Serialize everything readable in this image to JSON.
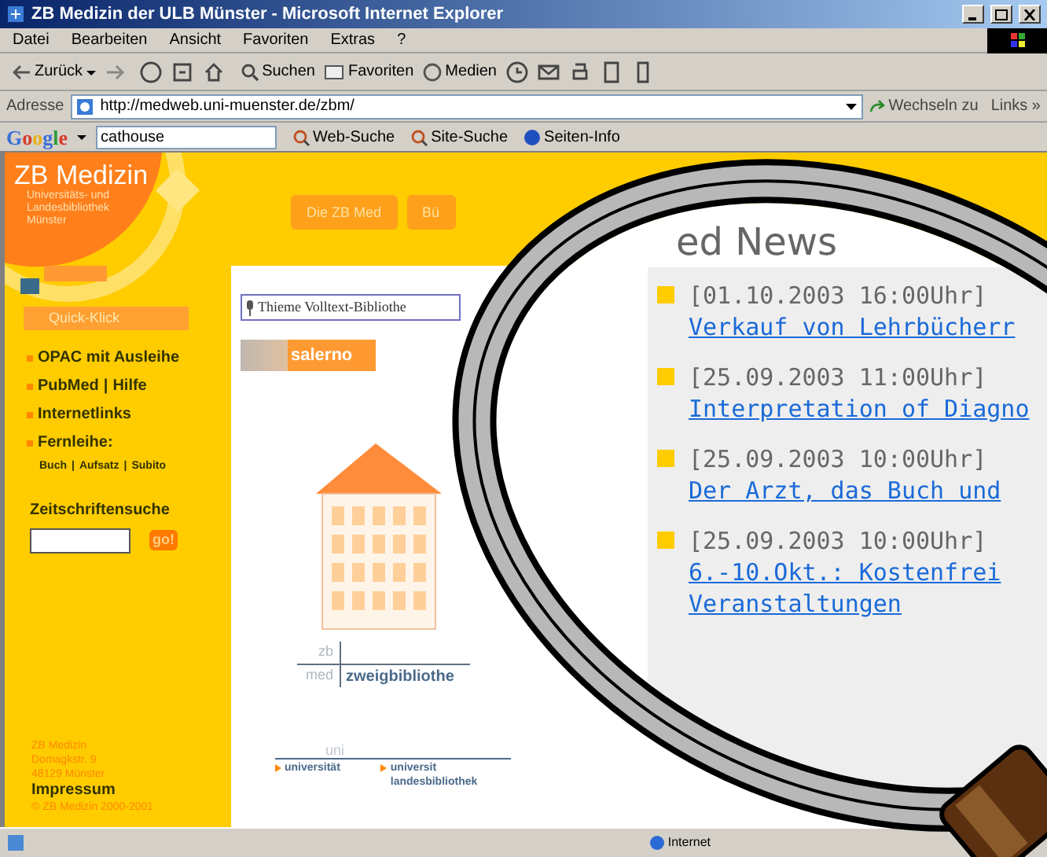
{
  "window": {
    "title": "ZB Medizin der ULB Münster - Microsoft Internet Explorer"
  },
  "menu": [
    "Datei",
    "Bearbeiten",
    "Ansicht",
    "Favoriten",
    "Extras",
    "?"
  ],
  "toolbar": {
    "back": "Zurück",
    "search": "Suchen",
    "favorites": "Favoriten",
    "media": "Medien"
  },
  "address_bar": {
    "label": "Adresse",
    "value": "http://medweb.uni-muenster.de/zbm/",
    "go": "Wechseln zu",
    "links": "Links »"
  },
  "google_bar": {
    "logo": "Google",
    "query": "cathouse",
    "buttons": [
      "Web-Suche",
      "Site-Suche",
      "Seiten-Info"
    ]
  },
  "sidebar": {
    "logo_title": "ZB Medizin",
    "logo_subtitle": [
      "Universitäts- und",
      "Landesbibliothek",
      "Münster"
    ],
    "quick_title": "Quick-Klick",
    "links": [
      {
        "parts": [
          "OPAC mit Ausleihe"
        ]
      },
      {
        "parts": [
          "PubMed",
          "|",
          "Hilfe"
        ]
      },
      {
        "parts": [
          "Internetlinks"
        ]
      },
      {
        "parts": [
          "Fernleihe:"
        ]
      }
    ],
    "sublinks": [
      "Buch",
      "|",
      "Aufsatz",
      "|",
      "Subito"
    ],
    "search_title": "Zeitschriftensuche",
    "search_button": "go!",
    "address": [
      "ZB Medizin",
      "Domagkstr. 9",
      "48129 Münster"
    ],
    "imprint": "Impressum",
    "copyright": "© ZB Medizin 2000-2001"
  },
  "nav_tabs": [
    "Die ZB Med",
    "Bü"
  ],
  "page": {
    "thieme": "Thieme Volltext-Bibliothe",
    "salerno": "salerno",
    "zb": "zb",
    "med": "med",
    "zweig": "zweigbibliothe",
    "uni": "uni",
    "universitaet": "universität",
    "ulb": [
      "universit",
      "landesbibliothek"
    ]
  },
  "news": {
    "title": "ed News",
    "items": [
      {
        "date": "[01.10.2003 16:00Uhr]",
        "lines": [
          "Verkauf von Lehrbücherr"
        ]
      },
      {
        "date": "[25.09.2003 11:00Uhr]",
        "lines": [
          "Interpretation of Diagno"
        ]
      },
      {
        "date": "[25.09.2003 10:00Uhr]",
        "lines": [
          "Der Arzt, das Buch und"
        ]
      },
      {
        "date": "[25.09.2003 10:00Uhr]",
        "lines": [
          "6.-10.Okt.: Kostenfrei",
          "Veranstaltungen"
        ]
      }
    ]
  },
  "status_bar": {
    "zone": "Internet"
  }
}
